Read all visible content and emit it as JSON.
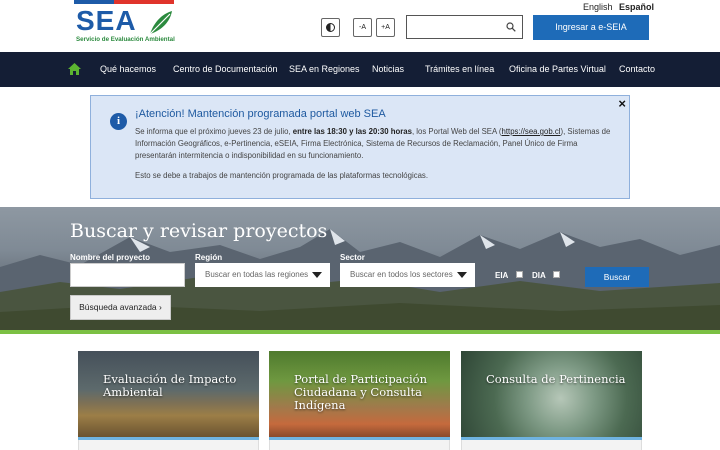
{
  "brand": {
    "logo_text": "SEA",
    "subtitle": "Servicio de Evaluación Ambiental"
  },
  "language": {
    "english": "English",
    "spanish": "Español"
  },
  "accessibility": {
    "contrast_icon": "contrast-icon",
    "font_decrease": "-A",
    "font_increase": "+A"
  },
  "search": {
    "placeholder": "",
    "icon": "search-icon"
  },
  "header_button": "Ingresar a e-SEIA",
  "nav": {
    "home_icon": "home-icon",
    "items": [
      "Qué hacemos",
      "Centro de Documentación",
      "SEA en Regiones",
      "Noticias",
      "Trámites en línea",
      "Oficina de Partes Virtual",
      "Contacto"
    ]
  },
  "alert": {
    "title": "¡Atención! Mantención programada portal web SEA",
    "p1_a": "Se informa que el próximo jueves 23 de julio, ",
    "p1_bold": "entre las 18:30 y las 20:30 horas",
    "p1_b": ", los Portal Web del SEA (",
    "p1_link": "https://sea.gob.cl",
    "p1_c": "), Sistemas de Información Geográficos, e-Pertinencia, eSEIA, Firma Electrónica, Sistema de Recursos de Reclamación, Panel Único de Firma presentarán intermitencia o indisponibilidad en su funcionamiento.",
    "p2": "Esto se debe a trabajos de mantención programada de las plataformas tecnológicas.",
    "close": "×",
    "info_icon": "i"
  },
  "project_search": {
    "title": "Buscar y revisar proyectos",
    "name_label": "Nombre del proyecto",
    "name_value": "",
    "region_label": "Región",
    "region_selected": "Buscar en todas las regiones",
    "sector_label": "Sector",
    "sector_selected": "Buscar en todos los sectores",
    "eia_label": "EIA",
    "dia_label": "DIA",
    "eia_checked": false,
    "dia_checked": false,
    "search_button": "Buscar",
    "advanced_button": "Búsqueda avanzada ›"
  },
  "cards": [
    {
      "title": "Evaluación de Impacto Ambiental"
    },
    {
      "title": "Portal de Participación Ciudadana y Consulta Indígena"
    },
    {
      "title": "Consulta de Pertinencia"
    }
  ],
  "colors": {
    "primary": "#1e6bb8",
    "nav_bg": "#141e35",
    "accent_green": "#7bc043",
    "alert_bg": "#dbe6f6"
  }
}
